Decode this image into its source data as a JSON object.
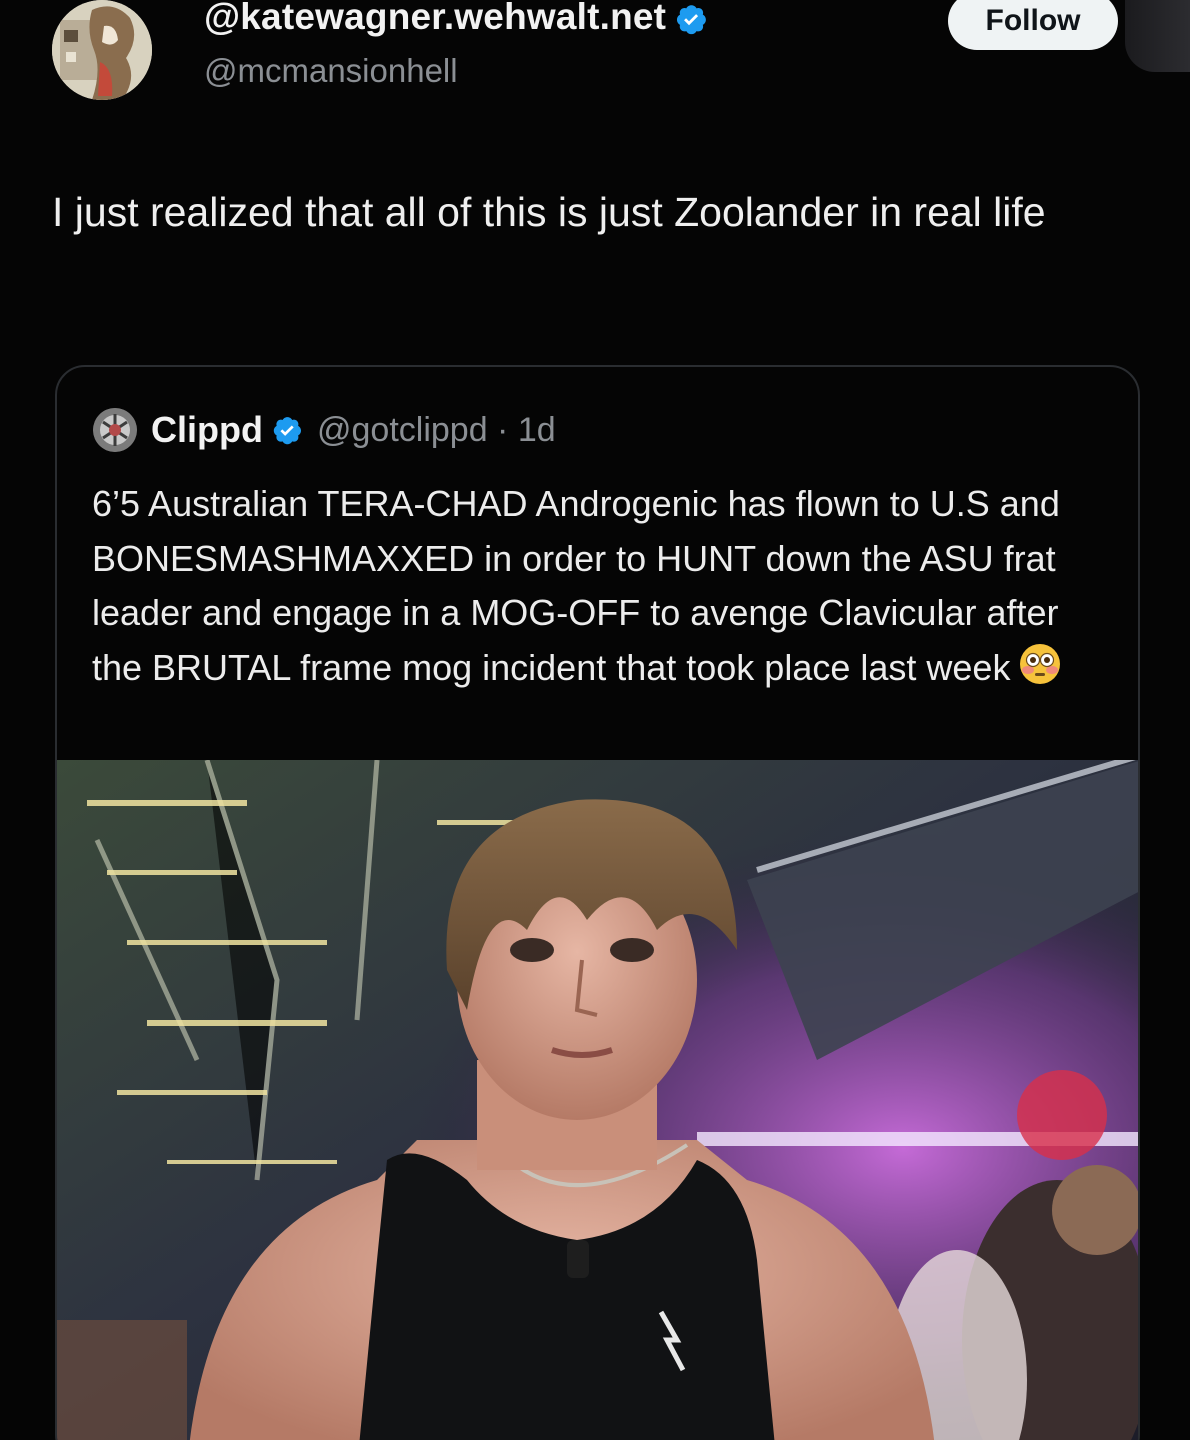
{
  "header": {
    "display_name": "@katewagner.wehwalt.net",
    "handle": "@mcmansionhell",
    "follow_label": "Follow",
    "avatar_icon": "profile-avatar-icon",
    "verified_icon": "verified-badge-icon",
    "verified_color": "#1d9bf0"
  },
  "tweet": {
    "text": "I just realized that all of this is just Zoolander in real life"
  },
  "quoted": {
    "name": "Clippd",
    "handle_time": "@gotclippd · 1d",
    "text": "6’5 Australian TERA-CHAD Androgenic has flown to U.S and BONESMASHMAXXED in order to HUNT down the ASU frat leader and engage in a MOG-OFF to avenge Clavicular after the BRUTAL frame mog incident that took place last week",
    "emoji_icon": "flushed-face-emoji-icon",
    "media_icon": "video-photo-icon"
  },
  "colors": {
    "background": "#050505",
    "text": "#efefef",
    "muted": "#8b8f94",
    "follow_bg": "#eff3f4"
  }
}
